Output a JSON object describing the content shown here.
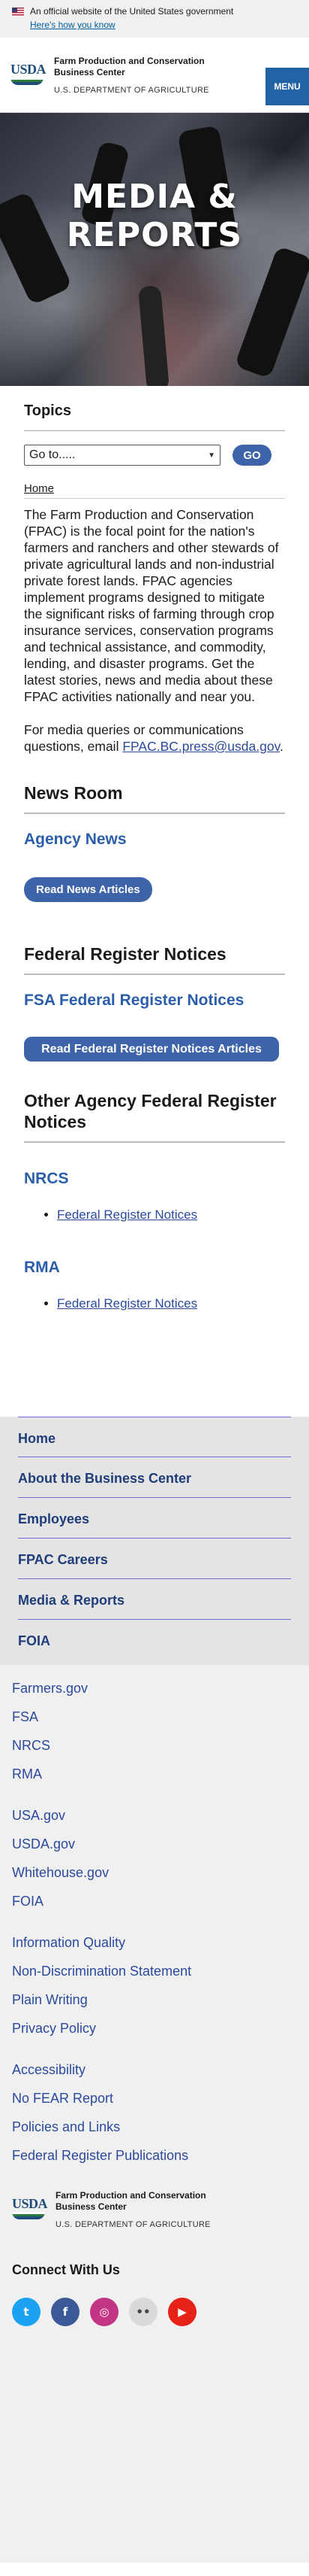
{
  "gov_banner": {
    "text": "An official website of the United States government",
    "link": "Here's how you know"
  },
  "header": {
    "logo_text": "USDA",
    "title": "Farm Production and Conservation Business Center",
    "subtitle": "U.S. DEPARTMENT OF AGRICULTURE",
    "menu_label": "MENU"
  },
  "hero": {
    "title": "MEDIA & REPORTS"
  },
  "topics": {
    "title": "Topics",
    "select_value": "Go to.....",
    "go_label": "GO"
  },
  "breadcrumb": {
    "home": "Home"
  },
  "intro": "The Farm Production and Conservation (FPAC) is the focal point for the nation's farmers and ranchers and other stewards of private agricultural lands and non-industrial private forest lands. FPAC agencies implement programs designed to mitigate the significant risks of farming through crop insurance services, conservation programs and technical assistance, and commodity, lending, and disaster programs. Get the latest stories, news and media about these FPAC activities nationally and near you.",
  "contact": {
    "text": "For media queries or communications questions, email",
    "email": "FPAC.BC.press@usda.gov",
    "period": "."
  },
  "news_room": {
    "title": "News Room",
    "link": "Agency News",
    "button": "Read News Articles"
  },
  "federal_register": {
    "title": "Federal Register Notices",
    "link": "FSA Federal Register Notices",
    "button": "Read Federal Register Notices Articles"
  },
  "other_agency": {
    "title": "Other Agency Federal Register Notices",
    "agencies": [
      {
        "name": "NRCS",
        "link": "Federal Register Notices"
      },
      {
        "name": "RMA",
        "link": "Federal Register Notices"
      }
    ]
  },
  "footer_nav": [
    "Home",
    "About the Business Center",
    "Employees",
    "FPAC Careers",
    "Media & Reports",
    "FOIA"
  ],
  "footer_links": {
    "group1": [
      "Farmers.gov",
      "FSA",
      "NRCS",
      "RMA"
    ],
    "group2": [
      "USA.gov",
      "USDA.gov",
      "Whitehouse.gov",
      "FOIA"
    ],
    "group3": [
      "Information Quality",
      "Non-Discrimination Statement",
      "Plain Writing",
      "Privacy Policy"
    ],
    "group4": [
      "Accessibility",
      "No FEAR Report",
      "Policies and Links",
      "Federal Register Publications"
    ]
  },
  "connect": {
    "title": "Connect With Us",
    "icons": [
      {
        "name": "twitter-icon",
        "glyph": "t",
        "color": "#1da1f2"
      },
      {
        "name": "facebook-icon",
        "glyph": "f",
        "color": "#3b5998"
      },
      {
        "name": "instagram-icon",
        "glyph": "◎",
        "color": "#c13584"
      },
      {
        "name": "flickr-icon",
        "glyph": "••",
        "color": "#d9d9d9"
      },
      {
        "name": "youtube-icon",
        "glyph": "▶",
        "color": "#e62117"
      }
    ]
  },
  "colors": {
    "menu_button": "#2263a6",
    "primary_button": "#3d63a8",
    "link": "#2b4a9e"
  }
}
